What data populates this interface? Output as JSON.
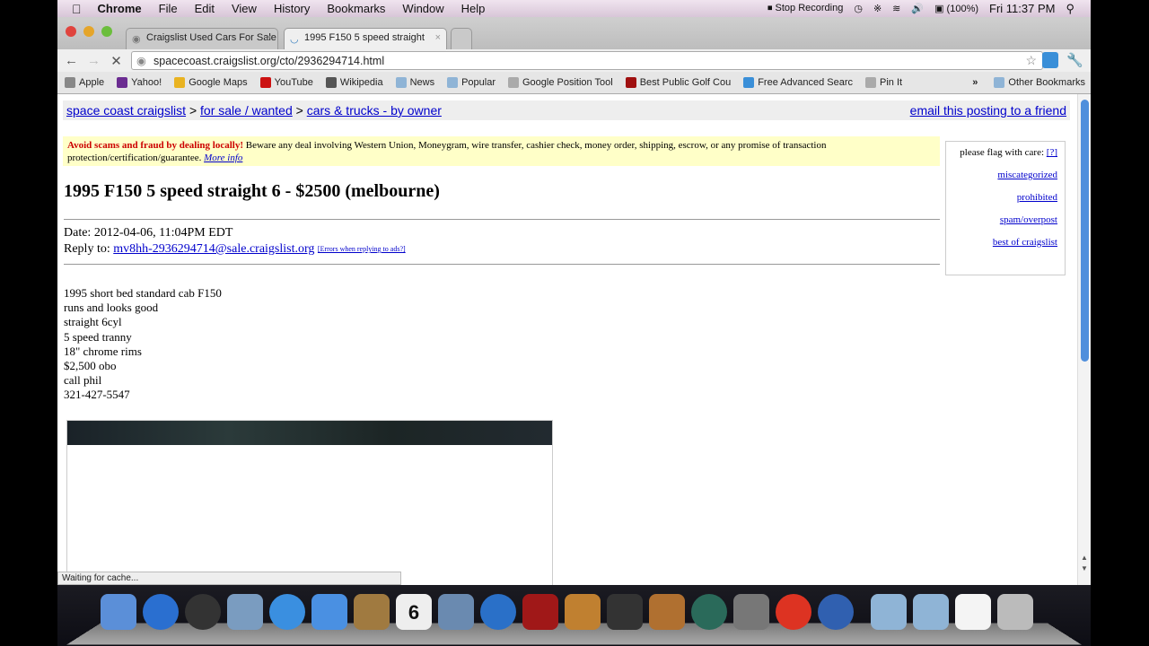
{
  "menubar": {
    "app": "Chrome",
    "items": [
      "File",
      "Edit",
      "View",
      "History",
      "Bookmarks",
      "Window",
      "Help"
    ],
    "stop_recording": "Stop Recording",
    "battery": "(100%)",
    "clock": "Fri 11:37 PM"
  },
  "tabs": [
    {
      "label": "Craigslist Used Cars For Sale",
      "active": false
    },
    {
      "label": "1995 F150 5 speed straight",
      "active": true
    }
  ],
  "url": "spacecoast.craigslist.org/cto/2936294714.html",
  "bookmarks": [
    {
      "label": "Apple",
      "icon": "apple-icon",
      "color": "#888"
    },
    {
      "label": "Yahoo!",
      "icon": "yahoo-icon",
      "color": "#6b2c91"
    },
    {
      "label": "Google Maps",
      "icon": "maps-icon",
      "color": "#e9b321"
    },
    {
      "label": "YouTube",
      "icon": "youtube-icon",
      "color": "#cc1111"
    },
    {
      "label": "Wikipedia",
      "icon": "wikipedia-icon",
      "color": "#555"
    },
    {
      "label": "News",
      "icon": "folder-icon",
      "color": "#8fb4d6"
    },
    {
      "label": "Popular",
      "icon": "folder-icon",
      "color": "#8fb4d6"
    },
    {
      "label": "Google Position Tool",
      "icon": "globe-icon",
      "color": "#aaa"
    },
    {
      "label": "Best Public Golf Cou",
      "icon": "g-icon",
      "color": "#a01010"
    },
    {
      "label": "Free Advanced Searc",
      "icon": "search-app-icon",
      "color": "#3a8fd8"
    },
    {
      "label": "Pin It",
      "icon": "globe-icon",
      "color": "#aaa"
    }
  ],
  "other_bookmarks": "Other Bookmarks",
  "page": {
    "breadcrumbs": [
      "space coast craigslist",
      "for sale / wanted",
      "cars & trucks - by owner"
    ],
    "email_link": "email this posting to a friend",
    "warning": {
      "bold": "Avoid scams and fraud by dealing locally!",
      "text": " Beware any deal involving Western Union, Moneygram, wire transfer, cashier check, money order, shipping, escrow, or any promise of transaction protection/certification/guarantee. ",
      "link": "More info"
    },
    "flag": {
      "label": "please flag with care:",
      "help": "[?]",
      "options": [
        "miscategorized",
        "prohibited",
        "spam/overpost",
        "best of craigslist"
      ]
    },
    "title": "1995 F150 5 speed straight 6 - $2500 (melbourne)",
    "date": "Date: 2012-04-06, 11:04PM EDT",
    "reply_label": "Reply to: ",
    "reply_email": "mv8hh-2936294714@sale.craigslist.org",
    "reply_errors": "[Errors when replying to ads?]",
    "body": [
      "1995 short bed standard cab F150",
      "runs and looks good",
      "straight 6cyl",
      "5 speed tranny",
      "18\" chrome rims",
      "$2,500 obo",
      "call phil",
      "321-427-5547"
    ]
  },
  "status": "Waiting for cache...",
  "scroll_position": 0,
  "dock": [
    {
      "name": "finder",
      "color": "#5b8fd8"
    },
    {
      "name": "app-store",
      "color": "#2a6fd0"
    },
    {
      "name": "dashboard",
      "color": "#333"
    },
    {
      "name": "mail",
      "color": "#7a9cc0"
    },
    {
      "name": "safari",
      "color": "#3a8fe0"
    },
    {
      "name": "facetime",
      "color": "#4a90e2"
    },
    {
      "name": "address-book",
      "color": "#a07a40"
    },
    {
      "name": "calendar",
      "color": "#eee"
    },
    {
      "name": "iphoto",
      "color": "#6a8ab0"
    },
    {
      "name": "itunes",
      "color": "#2a70c8"
    },
    {
      "name": "photo-booth",
      "color": "#a01818"
    },
    {
      "name": "image-capture",
      "color": "#c08030"
    },
    {
      "name": "imovie",
      "color": "#333"
    },
    {
      "name": "garageband",
      "color": "#b07030"
    },
    {
      "name": "time-machine",
      "color": "#2a6a5a"
    },
    {
      "name": "system-preferences",
      "color": "#777"
    },
    {
      "name": "chrome",
      "color": "#dd3322"
    },
    {
      "name": "quicktime",
      "color": "#3060b0"
    },
    {
      "name": "applications-folder",
      "color": "#8fb4d6"
    },
    {
      "name": "documents-folder",
      "color": "#8fb4d6"
    },
    {
      "name": "document",
      "color": "#f4f4f4"
    },
    {
      "name": "trash",
      "color": "#bbb"
    }
  ],
  "calendar_day": "6"
}
